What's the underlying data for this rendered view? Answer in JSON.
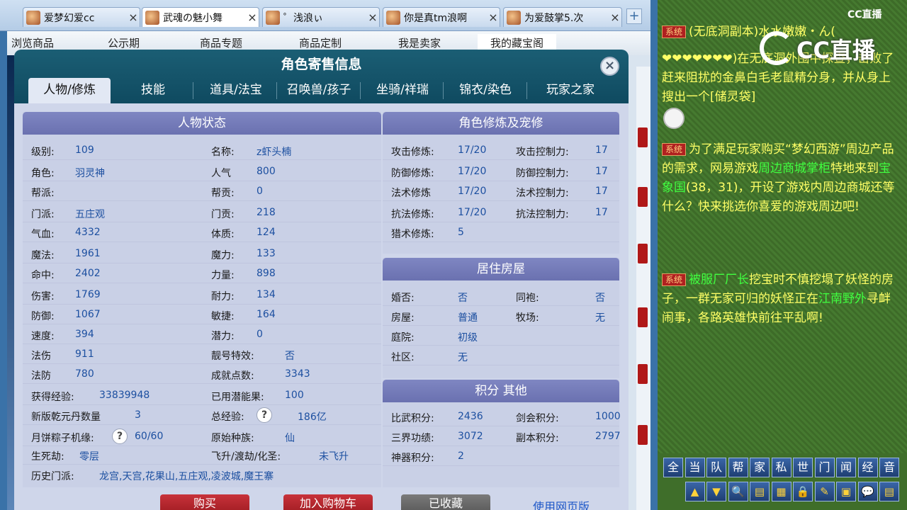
{
  "browser_tabs": [
    {
      "title": "爱梦幻爱cc",
      "close": "×"
    },
    {
      "title": "武魂の魅小舞",
      "close": "×"
    },
    {
      "title": "゜浅浪ぃ",
      "close": "×"
    },
    {
      "title": "你是真tm浪啊",
      "close": "×"
    },
    {
      "title": "为爱鼓掌5.次",
      "close": "×"
    }
  ],
  "new_tab": "+",
  "page_nav": [
    "浏览商品",
    "公示期",
    "商品专题",
    "商品定制",
    "我是卖家",
    "我的藏宝阁"
  ],
  "modal": {
    "title": "角色寄售信息",
    "close": "×",
    "tabs": [
      "人物/修炼",
      "技能",
      "道具/法宝",
      "召唤兽/孩子",
      "坐骑/祥瑞",
      "锦衣/染色",
      "玩家之家"
    ]
  },
  "status": {
    "header": "人物状态",
    "left": [
      {
        "label": "级别:",
        "value": "109"
      },
      {
        "label": "角色:",
        "value": "羽灵神"
      },
      {
        "label": "帮派:",
        "value": ""
      },
      {
        "label": "门派:",
        "value": "五庄观"
      },
      {
        "label": "气血:",
        "value": "4332"
      },
      {
        "label": "魔法:",
        "value": "1961"
      },
      {
        "label": "命中:",
        "value": "2402"
      },
      {
        "label": "伤害:",
        "value": "1769"
      },
      {
        "label": "防御:",
        "value": "1067"
      },
      {
        "label": "速度:",
        "value": "394"
      },
      {
        "label": "法伤",
        "value": "911"
      },
      {
        "label": "法防",
        "value": "780"
      },
      {
        "label": "获得经验:",
        "value": "33839948"
      },
      {
        "label": "新版乾元丹数量",
        "value": "3"
      },
      {
        "label": "月饼粽子机缘:",
        "value": "60/60"
      },
      {
        "label": "生死劫:",
        "value": "零层"
      }
    ],
    "right": [
      {
        "label": "名称:",
        "value": "z虾头楠"
      },
      {
        "label": "人气",
        "value": "800"
      },
      {
        "label": "帮贡:",
        "value": "0"
      },
      {
        "label": "门贡:",
        "value": "218"
      },
      {
        "label": "体质:",
        "value": "124"
      },
      {
        "label": "魔力:",
        "value": "133"
      },
      {
        "label": "力量:",
        "value": "898"
      },
      {
        "label": "耐力:",
        "value": "134"
      },
      {
        "label": "敏捷:",
        "value": "164"
      },
      {
        "label": "潜力:",
        "value": "0"
      },
      {
        "label": "靓号特效:",
        "value": "否"
      },
      {
        "label": "成就点数:",
        "value": "3343"
      },
      {
        "label": "已用潜能果:",
        "value": "100"
      },
      {
        "label": "总经验:",
        "value": "186亿"
      },
      {
        "label": "原始种族:",
        "value": "仙"
      },
      {
        "label": "飞升/渡劫/化圣:",
        "value": "未飞升"
      }
    ],
    "help_glyph": "?",
    "history_label": "历史门派:",
    "history_value": "龙宫,天宫,花果山,五庄观,凌波城,魔王寨"
  },
  "cultivation": {
    "header": "角色修炼及宠修",
    "rows": [
      {
        "l_label": "攻击修炼:",
        "l_value": "17/20",
        "r_label": "攻击控制力:",
        "r_value": "17"
      },
      {
        "l_label": "防御修炼:",
        "l_value": "17/20",
        "r_label": "防御控制力:",
        "r_value": "17"
      },
      {
        "l_label": "法术修炼",
        "l_value": "17/20",
        "r_label": "法术控制力:",
        "r_value": "17"
      },
      {
        "l_label": "抗法修炼:",
        "l_value": "17/20",
        "r_label": "抗法控制力:",
        "r_value": "17"
      },
      {
        "l_label": "猎术修炼:",
        "l_value": "5",
        "r_label": "",
        "r_value": ""
      }
    ]
  },
  "housing": {
    "header": "居住房屋",
    "rows": [
      {
        "l_label": "婚否:",
        "l_value": "否",
        "r_label": "同袍:",
        "r_value": "否"
      },
      {
        "l_label": "房屋:",
        "l_value": "普通",
        "r_label": "牧场:",
        "r_value": "无"
      },
      {
        "l_label": "庭院:",
        "l_value": "初级",
        "r_label": "",
        "r_value": ""
      },
      {
        "l_label": "社区:",
        "l_value": "无",
        "r_label": "",
        "r_value": ""
      }
    ]
  },
  "points": {
    "header": "积分 其他",
    "rows": [
      {
        "l_label": "比武积分:",
        "l_value": "2436",
        "r_label": "剑会积分:",
        "r_value": "1000"
      },
      {
        "l_label": "三界功绩:",
        "l_value": "3072",
        "r_label": "副本积分:",
        "r_value": "2797"
      },
      {
        "l_label": "神器积分:",
        "l_value": "2",
        "r_label": "",
        "r_value": ""
      }
    ]
  },
  "buttons": {
    "buy": "购买",
    "cart": "加入购物车",
    "saved": "已收藏",
    "web": "使用网页版"
  },
  "chat": {
    "logo": "CC直播",
    "big_logo": "CC直播",
    "sys_tag": "系统",
    "msg1": "(无底洞副本)水水嫩嫩・ん(",
    "msg1b": "❤❤❤❤❤❤❤)在无底洞外围中探查，击败了赶来阻扰的金鼻白毛老鼠精分身，并从身上搜出一个[储灵袋]",
    "msg2a": "为了满足玩家购买“梦幻西游”周边产品的需求，网易游戏",
    "msg2b": "周边商城掌柜",
    "msg2c": "特地来到",
    "msg2d": "宝象国",
    "msg2e": "(38，31)，开设了游戏内周边商城",
    "msg2f": "还等什么？快来挑选你喜爱的游戏周边吧!",
    "msg3a": "被服厂厂长",
    "msg3b": "挖宝时不慎挖塌了妖怪的房子，一群无家可归的妖怪正在",
    "msg3c": "江南野外",
    "msg3d": "寻衅闹事，各路英雄快前往平乱啊!",
    "channels": [
      "全",
      "当",
      "队",
      "帮",
      "家",
      "私",
      "世",
      "门",
      "闻",
      "经",
      "音"
    ],
    "tools": [
      "▲",
      "▼",
      "🔍",
      "▤",
      "▦",
      "🔒",
      "✎",
      "▣",
      "💬",
      "▤"
    ]
  }
}
